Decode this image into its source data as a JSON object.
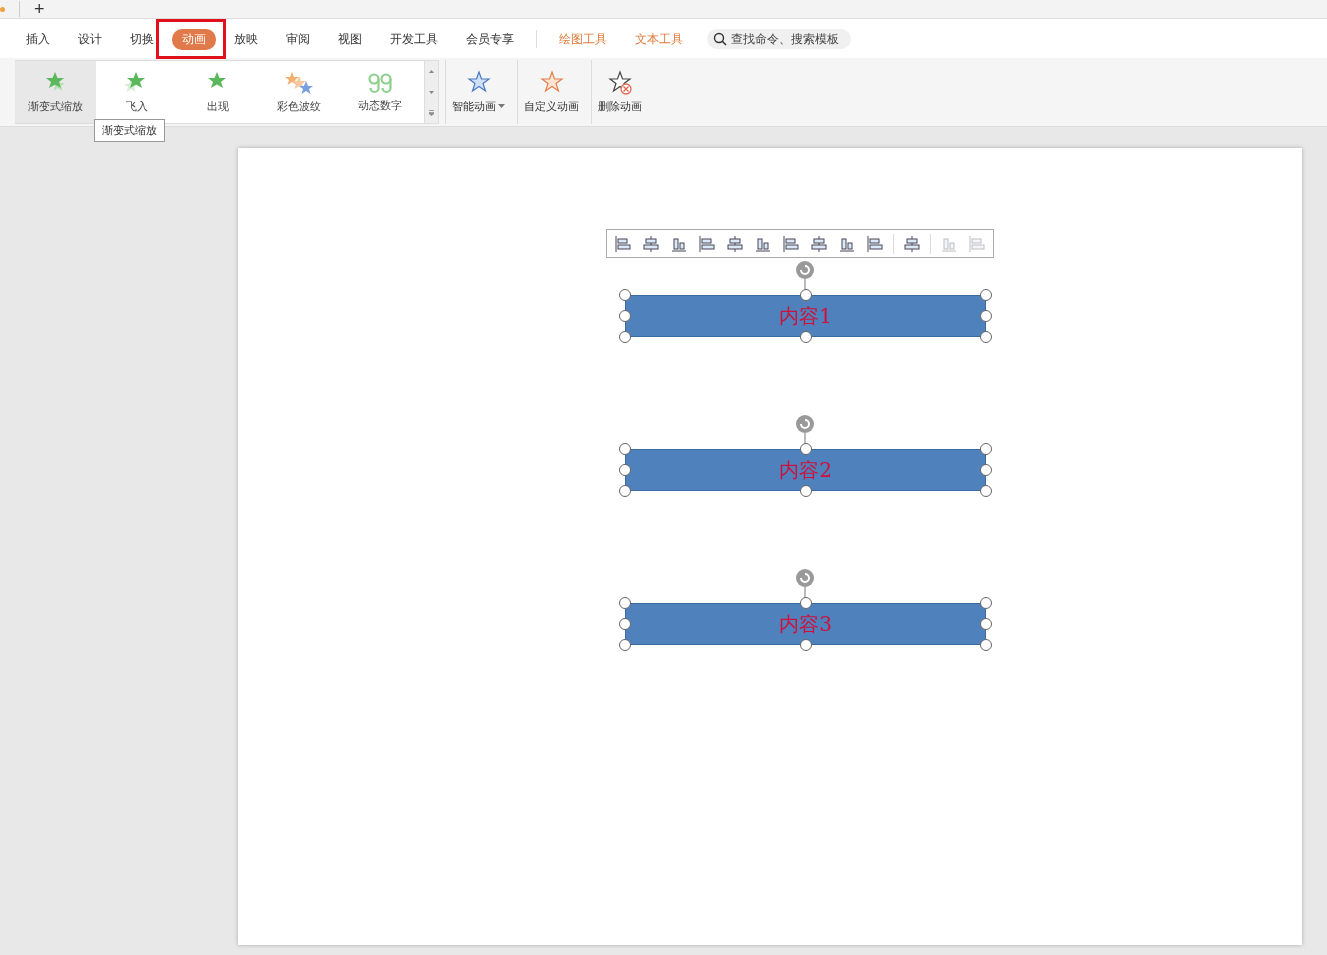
{
  "tab_strip": {
    "new_tab": "+"
  },
  "menu": [
    {
      "label": "插入",
      "selected": false,
      "kind": "normal"
    },
    {
      "label": "设计",
      "selected": false,
      "kind": "normal"
    },
    {
      "label": "切换",
      "selected": false,
      "kind": "normal"
    },
    {
      "label": "动画",
      "selected": true,
      "kind": "normal"
    },
    {
      "label": "放映",
      "selected": false,
      "kind": "normal"
    },
    {
      "label": "审阅",
      "selected": false,
      "kind": "normal"
    },
    {
      "label": "视图",
      "selected": false,
      "kind": "normal"
    },
    {
      "label": "开发工具",
      "selected": false,
      "kind": "normal"
    },
    {
      "label": "会员专享",
      "selected": false,
      "kind": "normal"
    },
    {
      "label": "绘图工具",
      "selected": false,
      "kind": "context"
    },
    {
      "label": "文本工具",
      "selected": false,
      "kind": "context"
    }
  ],
  "search": {
    "placeholder": "查找命令、搜索模板"
  },
  "gallery": [
    {
      "label": "渐变式缩放",
      "selected": true,
      "kind": "zoom"
    },
    {
      "label": "飞入",
      "selected": false,
      "kind": "fly"
    },
    {
      "label": "出现",
      "selected": false,
      "kind": "appear"
    },
    {
      "label": "彩色波纹",
      "selected": false,
      "kind": "ripple"
    },
    {
      "label": "动态数字",
      "selected": false,
      "kind": "number"
    }
  ],
  "tooltip": "渐变式缩放",
  "ribbon_buttons": [
    {
      "label": "智能动画",
      "kind": "smart",
      "dropdown": true
    },
    {
      "label": "自定义动画",
      "kind": "custom",
      "dropdown": false
    },
    {
      "label": "删除动画",
      "kind": "delete",
      "dropdown": false
    }
  ],
  "align_toolbar": [
    {
      "disabled": false
    },
    {
      "disabled": false
    },
    {
      "disabled": false
    },
    {
      "disabled": false
    },
    {
      "disabled": false
    },
    {
      "disabled": false
    },
    {
      "disabled": false
    },
    {
      "disabled": false
    },
    {
      "disabled": false
    },
    {
      "disabled": false
    },
    {
      "disabled": false
    },
    {
      "disabled": true
    },
    {
      "disabled": true
    }
  ],
  "shapes": [
    {
      "text": "内容1",
      "selected": true
    },
    {
      "text": "内容2",
      "selected": true
    },
    {
      "text": "内容3",
      "selected": true
    }
  ]
}
